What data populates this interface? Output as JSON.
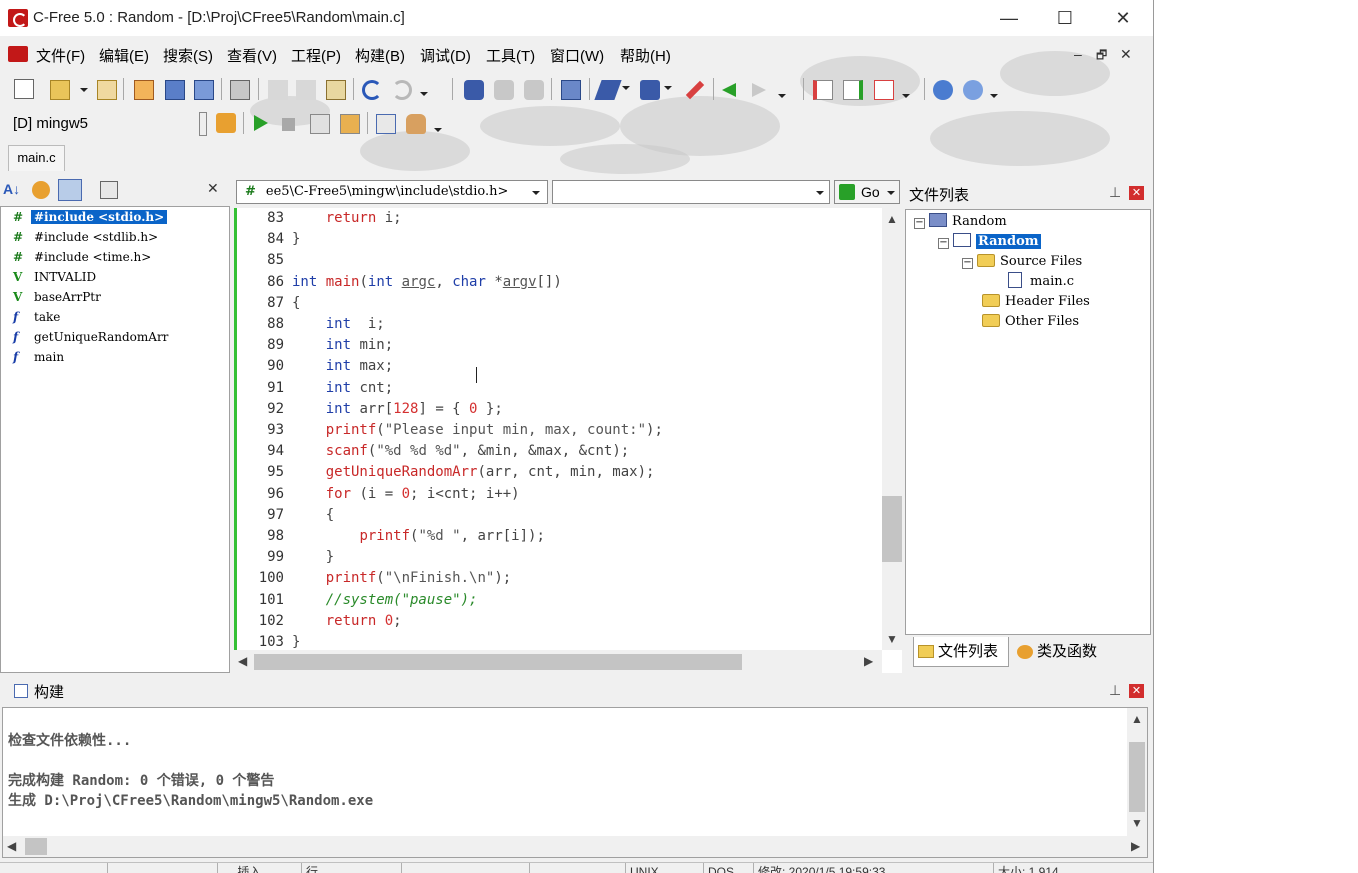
{
  "window": {
    "title": "C-Free 5.0 : Random - [D:\\Proj\\CFree5\\Random\\main.c]",
    "min_glyph": "—",
    "max_glyph": "☐",
    "close_glyph": "✕"
  },
  "menu": [
    {
      "label": "文件(F)"
    },
    {
      "label": "编辑(E)"
    },
    {
      "label": "搜索(S)"
    },
    {
      "label": "查看(V)"
    },
    {
      "label": "工程(P)"
    },
    {
      "label": "构建(B)"
    },
    {
      "label": "调试(D)"
    },
    {
      "label": "工具(T)"
    },
    {
      "label": "窗口(W)"
    },
    {
      "label": "帮助(H)"
    }
  ],
  "mdi_controls": {
    "min": "–",
    "restore": "🗗",
    "close": "✕"
  },
  "compiler": {
    "label": "[D] mingw5"
  },
  "doc_tab": {
    "label": "main.c"
  },
  "class_panel": {
    "items": [
      {
        "tag": "#",
        "label": "#include <stdio.h>",
        "selected": true
      },
      {
        "tag": "#",
        "label": "#include <stdlib.h>"
      },
      {
        "tag": "#",
        "label": "#include <time.h>"
      },
      {
        "tag": "V",
        "label": "INTVALID"
      },
      {
        "tag": "V",
        "label": "baseArrPtr"
      },
      {
        "tag": "f",
        "label": "take"
      },
      {
        "tag": "f",
        "label": "getUniqueRandomArr"
      },
      {
        "tag": "f",
        "label": "main"
      }
    ],
    "close_glyph": "✕"
  },
  "editor": {
    "include_combo": "ee5\\C-Free5\\mingw\\include\\stdio.h>",
    "symbol_combo": "",
    "go_label": "Go",
    "lines": [
      {
        "n": "83",
        "tokens": [
          [
            "kw",
            "    "
          ],
          [
            "fn",
            "return"
          ],
          [
            "id",
            " i;"
          ]
        ]
      },
      {
        "n": "84",
        "tokens": [
          [
            "id",
            "}"
          ]
        ]
      },
      {
        "n": "85",
        "tokens": []
      },
      {
        "n": "86",
        "tokens": [
          [
            "kw",
            "int"
          ],
          [
            "id",
            " "
          ],
          [
            "fn",
            "main"
          ],
          [
            "id",
            "("
          ],
          [
            "kw",
            "int"
          ],
          [
            "id",
            " "
          ],
          [
            "param",
            "argc"
          ],
          [
            "id",
            ", "
          ],
          [
            "kw",
            "char"
          ],
          [
            "id",
            " *"
          ],
          [
            "param",
            "argv"
          ],
          [
            "id",
            "[])"
          ]
        ]
      },
      {
        "n": "87",
        "tokens": [
          [
            "id",
            "{"
          ]
        ]
      },
      {
        "n": "88",
        "tokens": [
          [
            "id",
            "    "
          ],
          [
            "kw",
            "int"
          ],
          [
            "id",
            "  i;"
          ]
        ]
      },
      {
        "n": "89",
        "tokens": [
          [
            "id",
            "    "
          ],
          [
            "kw",
            "int"
          ],
          [
            "id",
            " min;"
          ]
        ]
      },
      {
        "n": "90",
        "tokens": [
          [
            "id",
            "    "
          ],
          [
            "kw",
            "int"
          ],
          [
            "id",
            " max;"
          ]
        ]
      },
      {
        "n": "91",
        "tokens": [
          [
            "id",
            "    "
          ],
          [
            "kw",
            "int"
          ],
          [
            "id",
            " cnt;"
          ]
        ]
      },
      {
        "n": "92",
        "tokens": [
          [
            "id",
            "    "
          ],
          [
            "kw",
            "int"
          ],
          [
            "id",
            " arr["
          ],
          [
            "num",
            "128"
          ],
          [
            "id",
            "] = { "
          ],
          [
            "num",
            "0"
          ],
          [
            "id",
            " };"
          ]
        ]
      },
      {
        "n": "93",
        "tokens": [
          [
            "id",
            "    "
          ],
          [
            "fn",
            "printf"
          ],
          [
            "id",
            "("
          ],
          [
            "str",
            "\"Please input min, max, count:\""
          ],
          [
            "id",
            ");"
          ]
        ]
      },
      {
        "n": "94",
        "tokens": [
          [
            "id",
            "    "
          ],
          [
            "fn",
            "scanf"
          ],
          [
            "id",
            "("
          ],
          [
            "str",
            "\"%d %d %d\""
          ],
          [
            "id",
            ", &min, &max, &cnt);"
          ]
        ]
      },
      {
        "n": "95",
        "tokens": [
          [
            "id",
            "    "
          ],
          [
            "fn",
            "getUniqueRandomArr"
          ],
          [
            "id",
            "(arr, cnt, min, max);"
          ]
        ]
      },
      {
        "n": "96",
        "tokens": [
          [
            "id",
            "    "
          ],
          [
            "fn",
            "for"
          ],
          [
            "id",
            " (i = "
          ],
          [
            "num",
            "0"
          ],
          [
            "id",
            "; i<cnt; i++)"
          ]
        ]
      },
      {
        "n": "97",
        "tokens": [
          [
            "id",
            "    {"
          ]
        ]
      },
      {
        "n": "98",
        "tokens": [
          [
            "id",
            "        "
          ],
          [
            "fn",
            "printf"
          ],
          [
            "id",
            "("
          ],
          [
            "str",
            "\"%d \""
          ],
          [
            "id",
            ", arr[i]);"
          ]
        ]
      },
      {
        "n": "99",
        "tokens": [
          [
            "id",
            "    }"
          ]
        ]
      },
      {
        "n": "100",
        "tokens": [
          [
            "id",
            "    "
          ],
          [
            "fn",
            "printf"
          ],
          [
            "id",
            "("
          ],
          [
            "str",
            "\"\\nFinish.\\n\""
          ],
          [
            "id",
            ");"
          ]
        ]
      },
      {
        "n": "101",
        "tokens": [
          [
            "id",
            "    "
          ],
          [
            "cm",
            "//system(\"pause\");"
          ]
        ]
      },
      {
        "n": "102",
        "tokens": [
          [
            "id",
            "    "
          ],
          [
            "fn",
            "return"
          ],
          [
            "id",
            " "
          ],
          [
            "num",
            "0"
          ],
          [
            "id",
            ";"
          ]
        ]
      },
      {
        "n": "103",
        "tokens": [
          [
            "id",
            "}"
          ]
        ]
      }
    ]
  },
  "file_panel": {
    "title": "文件列表",
    "project": "Random",
    "target": "Random",
    "source_folder": "Source Files",
    "source_file": "main.c",
    "header_folder": "Header Files",
    "other_folder": "Other Files",
    "tab_files": "文件列表",
    "tab_classes": "类及函数",
    "pin_glyph": "⊥",
    "close_glyph": "✕"
  },
  "build_panel": {
    "title": "构建",
    "lines": [
      "检查文件依赖性...",
      "",
      "完成构建 Random: 0 个错误, 0 个警告",
      "生成 D:\\Proj\\CFree5\\Random\\mingw5\\Random.exe"
    ],
    "pin_glyph": "⊥",
    "close_glyph": "✕"
  },
  "statusbar": {
    "cells": [
      "…  …",
      "",
      "…  插入",
      "行 …",
      "",
      "…",
      "UNIX",
      "DOS",
      "修改: 2020/1/5  19:59:33",
      "大小: 1,914"
    ]
  },
  "colors": {
    "selection": "#0a64c8",
    "gutter_green": "#34c034",
    "keyword": "#1f3ea8",
    "function": "#c82828",
    "comment": "#2a8a2a",
    "close_red": "#d22e2e"
  }
}
